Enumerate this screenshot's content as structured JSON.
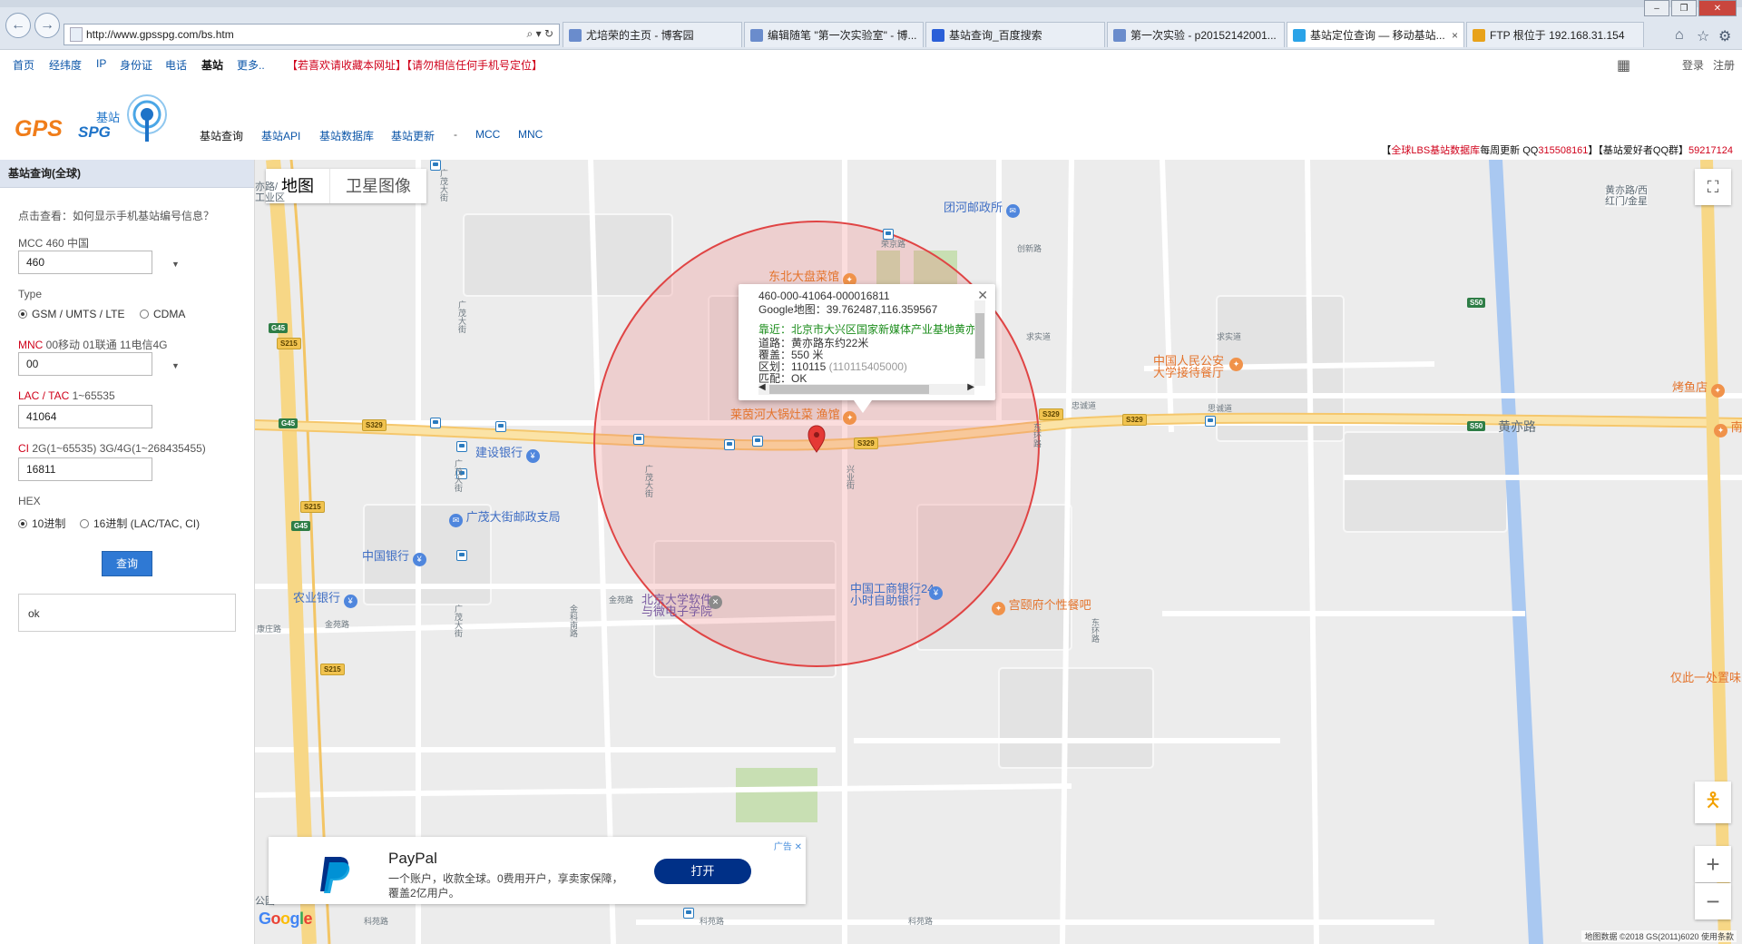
{
  "browser": {
    "url": "http://www.gpsspg.com/bs.htm",
    "tabs": [
      {
        "label": "尤培荣的主页 - 博客园",
        "color": "#6a8ccc"
      },
      {
        "label": "编辑随笔 \"第一次实验室\" - 博...",
        "color": "#6a8ccc"
      },
      {
        "label": "基站查询_百度搜索",
        "color": "#2a5fd8"
      },
      {
        "label": "第一次实验 - p20152142001...",
        "color": "#6a8ccc"
      },
      {
        "label": "基站定位查询 — 移动基站...",
        "color": "#2aa3e8"
      },
      {
        "label": "FTP 根位于 192.168.31.154",
        "color": "#e8a21a"
      }
    ],
    "close_glyph": "×"
  },
  "topnav": {
    "items": [
      "首页",
      "经纬度",
      "IP",
      "身份证",
      "电话",
      "基站",
      "更多.."
    ],
    "warning": "【若喜欢请收藏本网址】【请勿相信任何手机号定位】",
    "login": "登录",
    "register": "注册"
  },
  "header": {
    "logo_main": "GPS",
    "logo_sub": "SPG",
    "logo_cn": "基站",
    "nav": [
      "基站查询",
      "基站API",
      "基站数据库",
      "基站更新",
      "-",
      "MCC",
      "MNC"
    ],
    "info_prefix": "【",
    "info_db": "全球LBS基站数据库",
    "info_mid": "每周更新 QQ",
    "info_qq1": "315508161",
    "info_mid2": "】【基站爱好者QQ群】",
    "info_qq2": "59217124"
  },
  "sidebar": {
    "title": "基站查询(全球)",
    "hint": "点击查看：如何显示手机基站编号信息？",
    "mcc_label": "MCC 460 中国",
    "mcc_value": "460",
    "type_label": "Type",
    "type_options": [
      "GSM / UMTS / LTE",
      "CDMA"
    ],
    "mnc_label_red": "MNC",
    "mnc_label_rest": " 00移动 01联通 11电信4G",
    "mnc_value": "00",
    "lac_label_red": "LAC / TAC",
    "lac_label_rest": " 1~65535",
    "lac_value": "41064",
    "ci_label_red": "CI",
    "ci_label_rest": " 2G(1~65535) 3G/4G(1~268435455)",
    "ci_value": "16811",
    "hex_label": "HEX",
    "hex_options": [
      "10进制",
      "16进制 (LAC/TAC, CI)"
    ],
    "query_button": "查询",
    "result": "ok"
  },
  "map": {
    "type_map": "地图",
    "type_satellite": "卫星图像",
    "info": {
      "id": "460-000-41064-000016811",
      "google": "Google地图：39.762487,116.359567",
      "near": "靠近：北京市大兴区国家新媒体产业基地黄亦路",
      "road": "道路：黄亦路东约22米",
      "coverage": "覆盖：550 米",
      "region_label": "区划：110115",
      "region_code": "(110115405000)",
      "match": "匹配：OK"
    },
    "poi": {
      "tuanhe_post": "团河邮政所",
      "dongbei": "东北大盘菜馆",
      "laiyin": "莱茵河大锅灶菜 渔馆",
      "jianshe": "建设银行",
      "guangmao_post": "广茂大街邮政支局",
      "zhongguo_bank": "中国银行",
      "nongye_bank": "农业银行",
      "pku": "北京大学软件\n与微电子学院",
      "icbc": "中国工商银行24\n小时自助银行",
      "gongting": "宫颐府个性餐吧",
      "police_hotel": "中国人民公安\n大学接待餐厅",
      "kaoyu": "烤鱼店",
      "nanyuan": "南垣",
      "huangyi_road": "黄亦路",
      "huangyi_west": "黄亦路/西\n红门/金星",
      "huangyi_west2": "亦路/\n工业区",
      "yici": "仅此一处置味",
      "gongyuan": "公园"
    },
    "streets": [
      "康庄路",
      "金苑路",
      "金星路",
      "广茂大街",
      "兴业街",
      "东环路",
      "创新路",
      "荣京路",
      "北兴路",
      "求实道",
      "忠诚道",
      "思诚道",
      "科苑路",
      "金科南路"
    ],
    "shields": [
      "G45",
      "S215",
      "S329",
      "S50"
    ],
    "copyright": "地图数据 ©2018 GS(2011)6020   使用条款",
    "google_letters": [
      "G",
      "o",
      "o",
      "g",
      "l",
      "e"
    ]
  },
  "ad": {
    "title": "PayPal",
    "desc": "一个账户，收款全球。0费用开户，享卖家保障，\n覆盖2亿用户。",
    "button": "打开",
    "label": "广告 ✕"
  },
  "colors": {
    "link": "#0b55a8",
    "warning_red": "#d0021b",
    "circle_fill": "rgba(240,120,120,0.25)",
    "circle_stroke": "#e04444",
    "road_yellow": "#f7d786",
    "paypal_blue": "#003087"
  }
}
